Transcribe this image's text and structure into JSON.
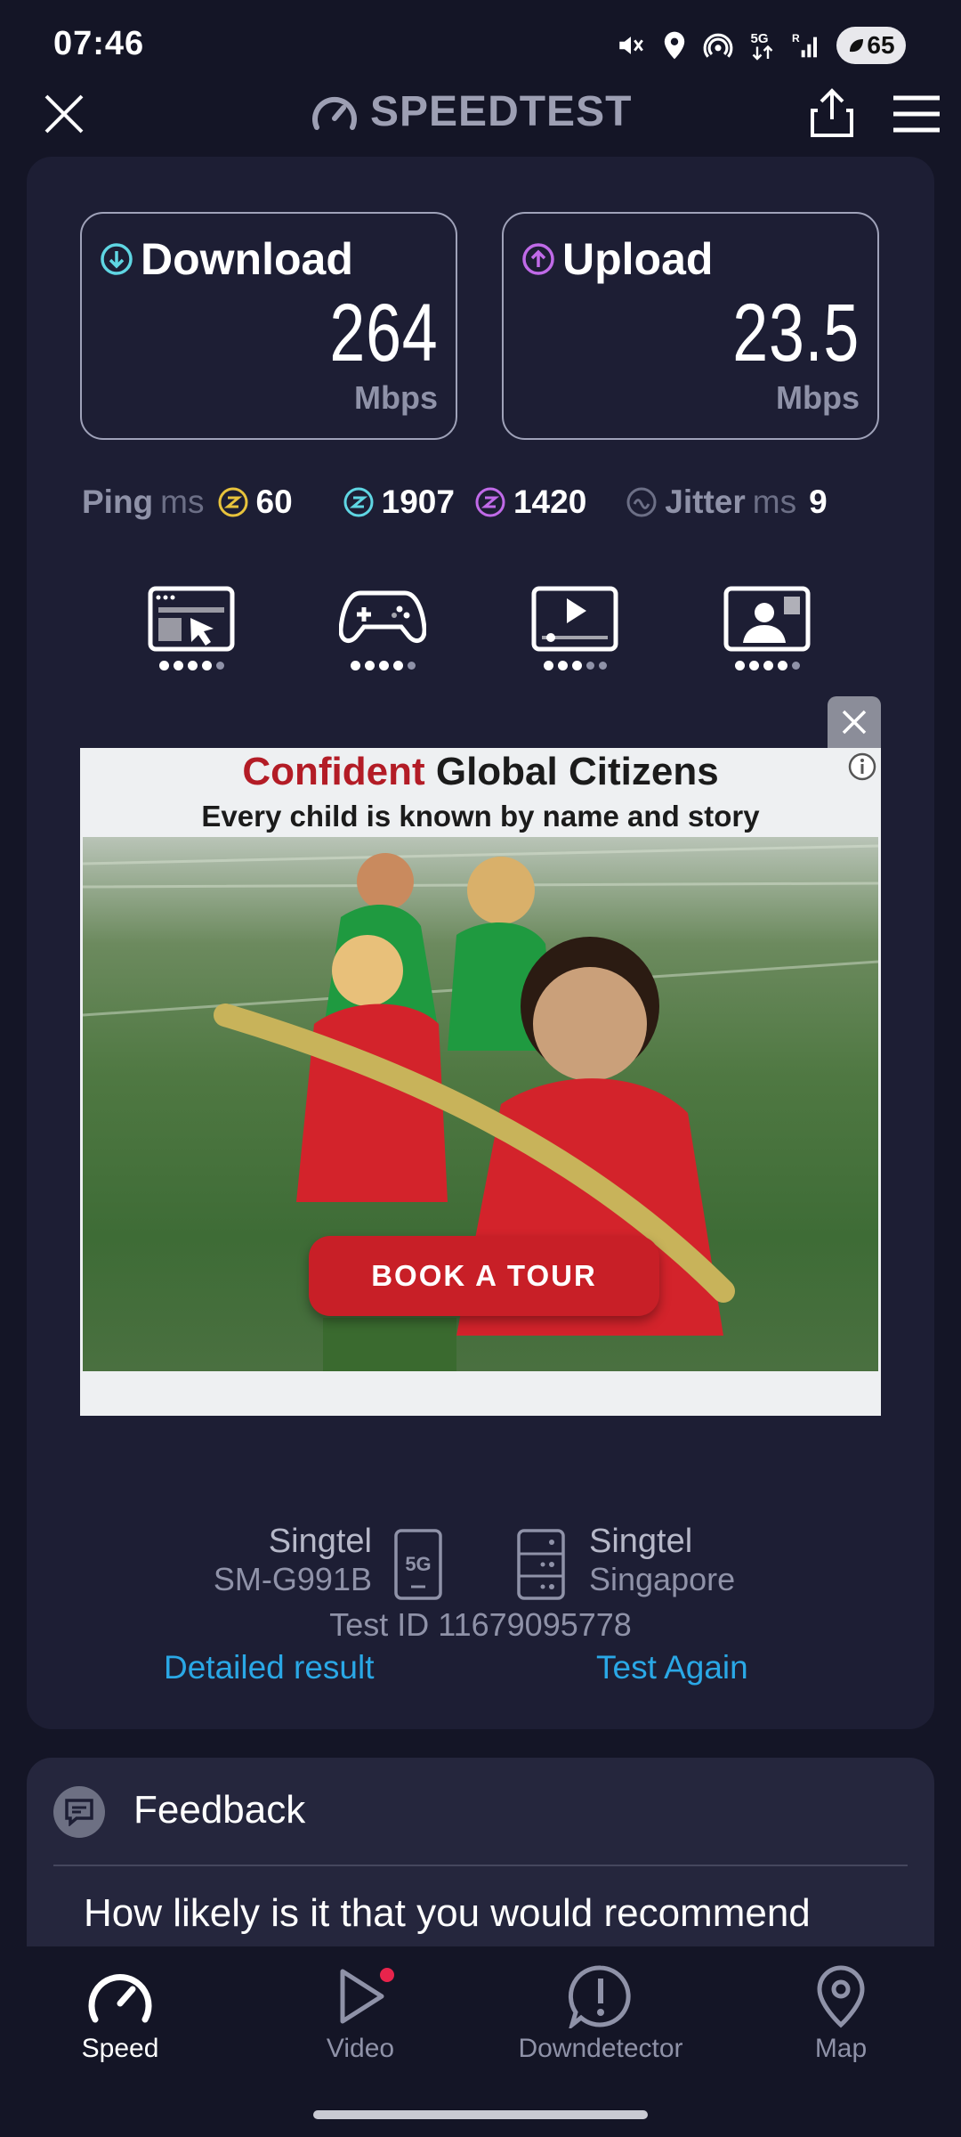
{
  "status_bar": {
    "time": "07:46",
    "battery": "65"
  },
  "header": {
    "title": "SPEEDTEST"
  },
  "results": {
    "download": {
      "label": "Download",
      "value": "264",
      "unit": "Mbps"
    },
    "upload": {
      "label": "Upload",
      "value": "23.5",
      "unit": "Mbps"
    },
    "ping": {
      "label": "Ping",
      "unit": "ms",
      "idle": "60",
      "download": "1907",
      "upload": "1420"
    },
    "jitter": {
      "label": "Jitter",
      "unit": "ms",
      "value": "9"
    },
    "quality": {
      "browsing": 4,
      "gaming": 4,
      "video": 3,
      "video_call": 4,
      "max": 5
    }
  },
  "ad": {
    "headline_accent": "Confident",
    "headline_rest": "Global Citizens",
    "subline": "Every child is known by name and story",
    "cta": "BOOK A TOUR"
  },
  "connection": {
    "provider": "Singtel",
    "device": "SM-G991B",
    "network_badge": "5G",
    "server_provider": "Singtel",
    "server_location": "Singapore",
    "test_id": "Test ID 11679095778"
  },
  "actions": {
    "detailed": "Detailed result",
    "again": "Test Again"
  },
  "feedback": {
    "title": "Feedback",
    "question": "How likely is it that you would recommend"
  },
  "nav": {
    "items": [
      {
        "label": "Speed",
        "active": true
      },
      {
        "label": "Video",
        "active": false
      },
      {
        "label": "Downdetector",
        "active": false
      },
      {
        "label": "Map",
        "active": false
      }
    ]
  },
  "colors": {
    "accent_download": "#5fd6e3",
    "accent_upload": "#c06ae8",
    "idle_ping": "#e8c33c",
    "link": "#2aa8e6",
    "ad_red": "#c81f27"
  }
}
